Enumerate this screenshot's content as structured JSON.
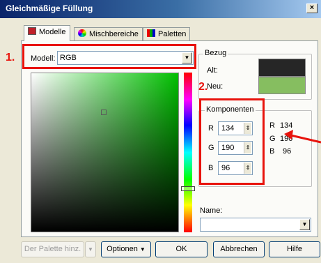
{
  "window": {
    "title": "Gleichmäßige Füllung",
    "close": "×"
  },
  "tabs": [
    {
      "label": "Modelle",
      "color": "#c0202a"
    },
    {
      "label": "Mischbereiche"
    },
    {
      "label": "Paletten"
    }
  ],
  "model": {
    "label": "Modell:",
    "value": "RGB"
  },
  "reference": {
    "title": "Bezug",
    "old_label": "Alt:",
    "new_label": "Neu:",
    "old_color": "#262626",
    "new_color": "#86be60"
  },
  "components": {
    "title": "Komponenten",
    "fields": [
      {
        "label": "R",
        "value": "134"
      },
      {
        "label": "G",
        "value": "190"
      },
      {
        "label": "B",
        "value": "96"
      }
    ],
    "readout": [
      {
        "label": "R",
        "value": "134"
      },
      {
        "label": "G",
        "value": "190"
      },
      {
        "label": "B",
        "value": "96"
      }
    ]
  },
  "name": {
    "label": "Name:",
    "value": ""
  },
  "buttons": {
    "palette": "Der Palette hinz.",
    "options": "Optionen",
    "ok": "OK",
    "cancel": "Abbrechen",
    "help": "Hilfe"
  },
  "annotations": {
    "one": "1.",
    "two": "2.",
    "color": "#e8130c"
  }
}
